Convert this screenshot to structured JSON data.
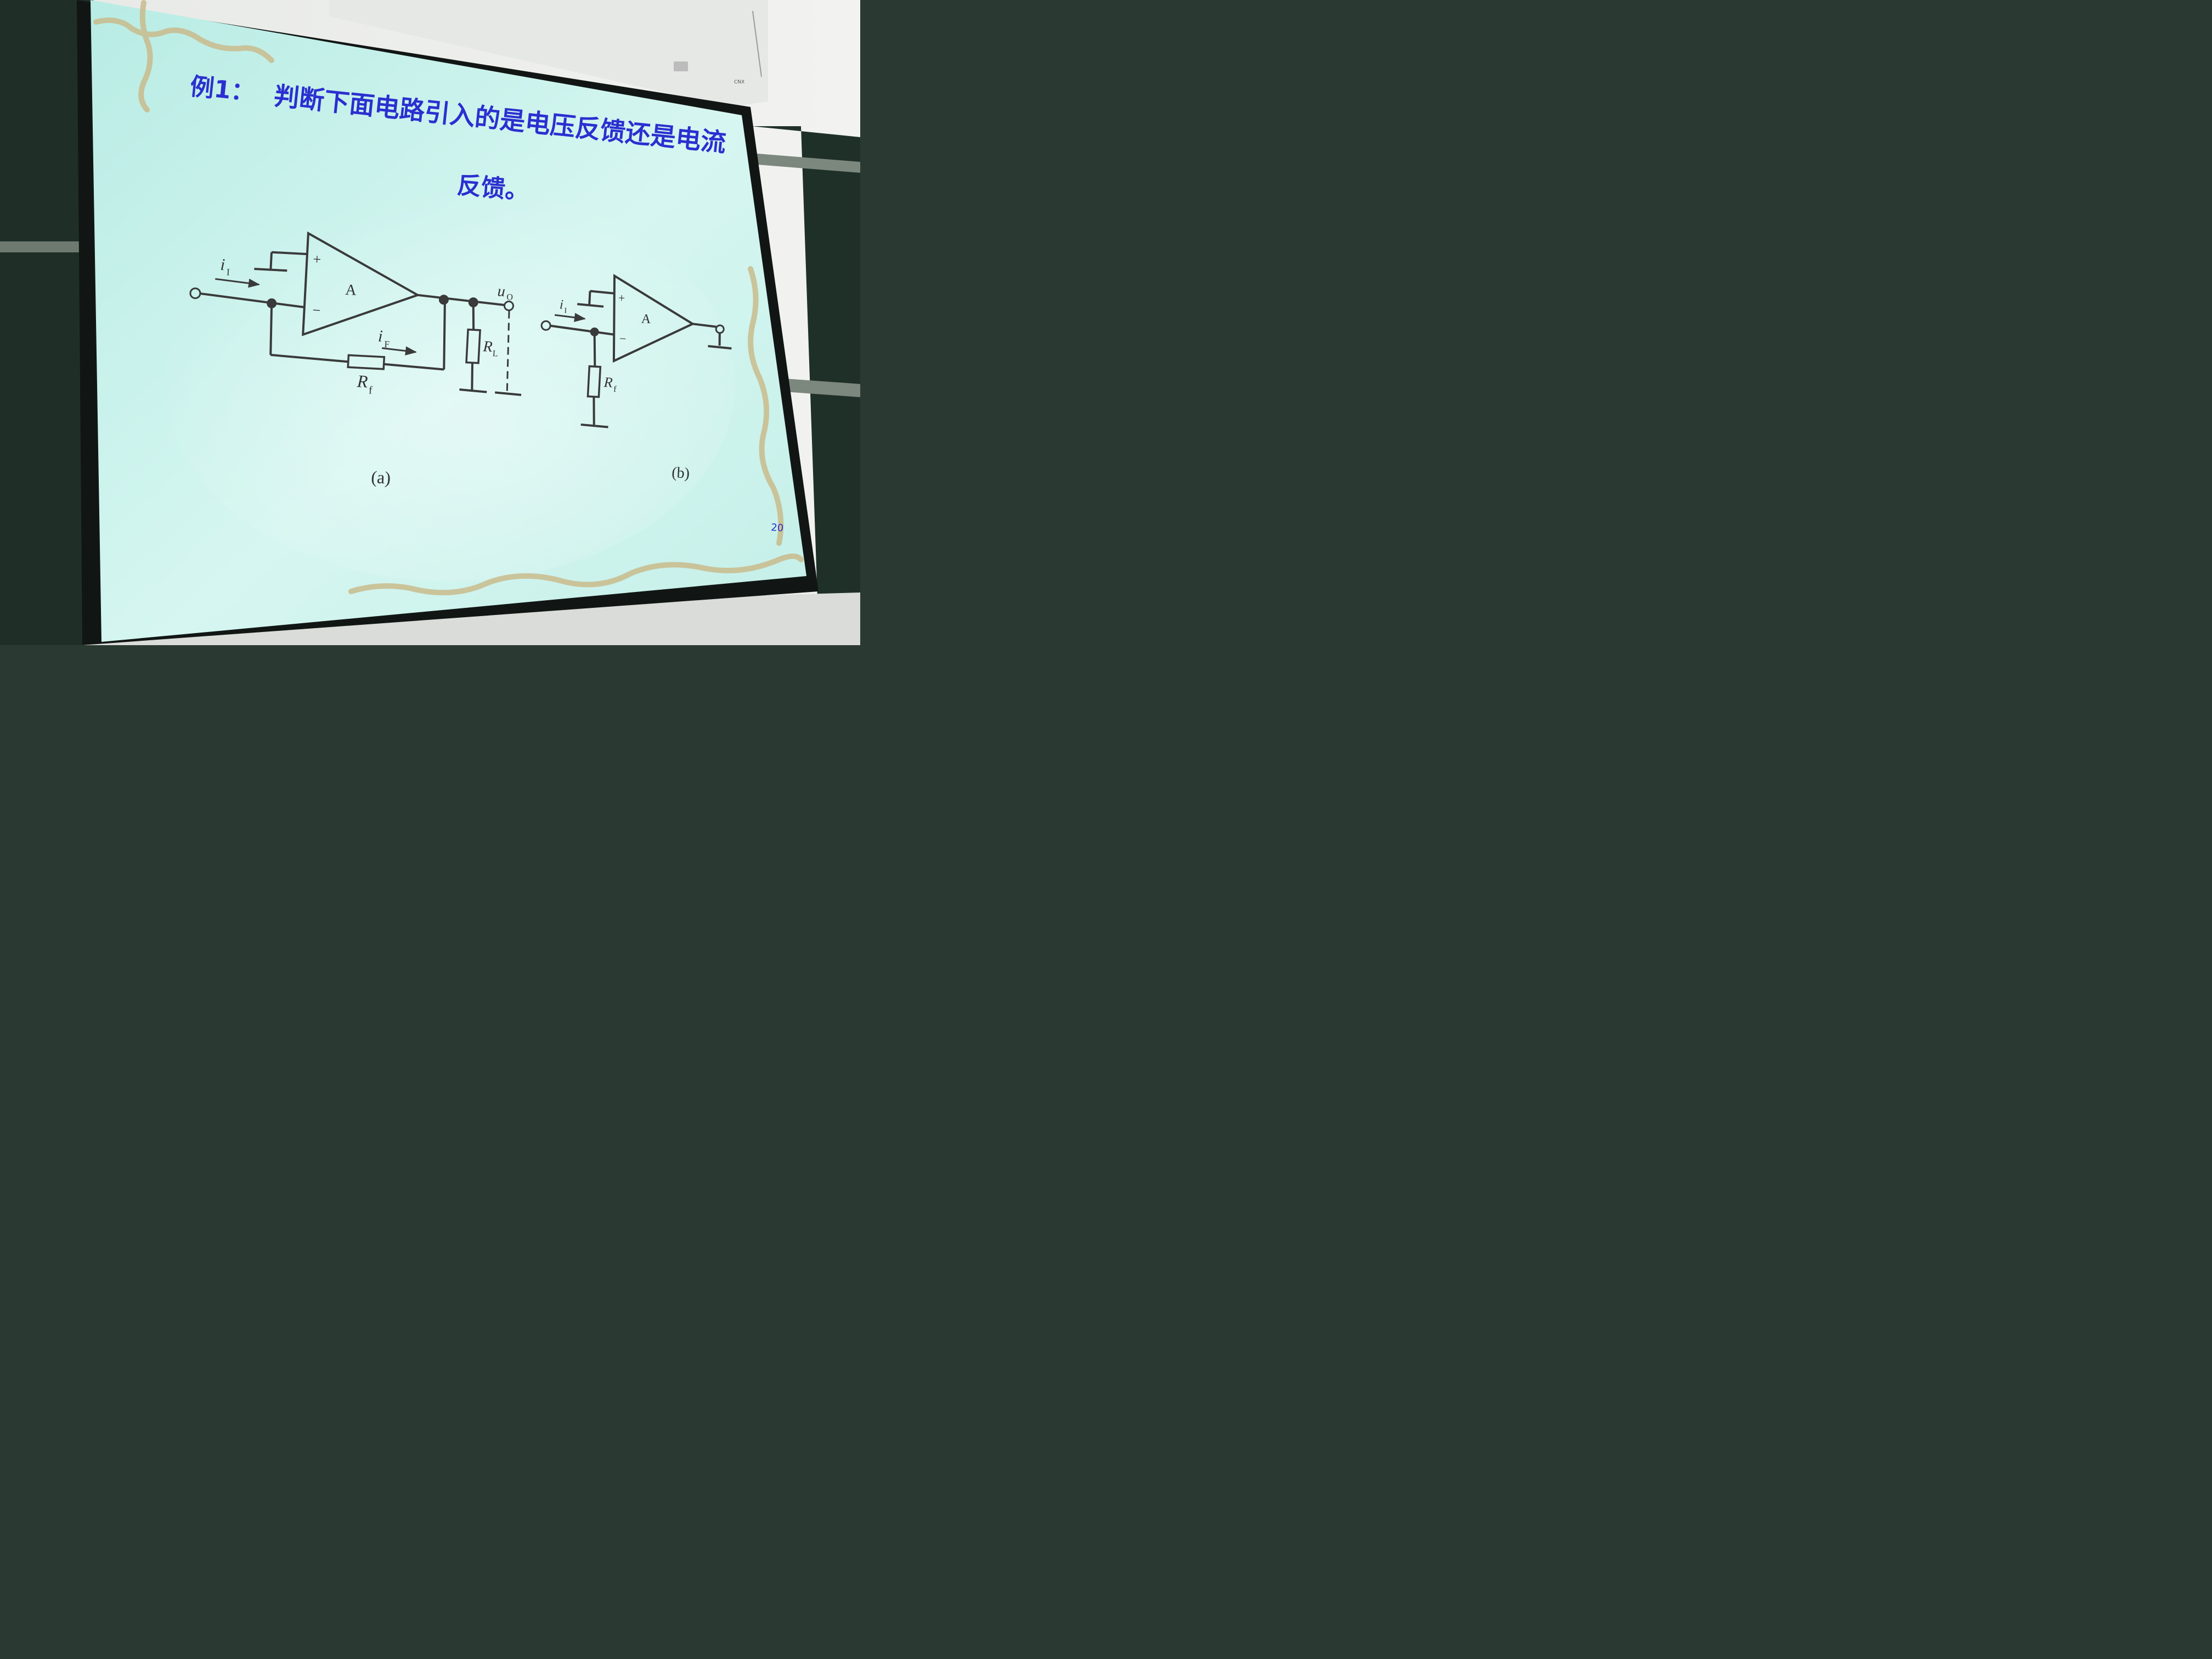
{
  "slide": {
    "title_prefix": "例1：",
    "title_line1": "判断下面电路引入的是电压反馈还是电流",
    "title_line2": "反馈。",
    "page_number": "20"
  },
  "circuit_a": {
    "caption": "(a)",
    "amp_label": "A",
    "plus": "+",
    "minus": "−",
    "input_current": "i",
    "input_current_sub": "I",
    "feedback_current": "i",
    "feedback_current_sub": "F",
    "feedback_resistor": "R",
    "feedback_resistor_sub": "f",
    "load_resistor": "R",
    "load_resistor_sub": "L",
    "output_voltage": "u",
    "output_voltage_sub": "O"
  },
  "circuit_b": {
    "caption": "(b)",
    "amp_label": "A",
    "plus": "+",
    "minus": "−",
    "input_current": "i",
    "input_current_sub": "I",
    "resistor": "R",
    "resistor_sub": "f"
  },
  "projector_label": "CNX",
  "colors": {
    "screen": "#c9f0ea",
    "title": "#2b2fd0",
    "wire": "#3a3a3a",
    "border_vine": "#c8b88a",
    "chalkboard": "#22332c",
    "wall": "#e9ece8"
  }
}
